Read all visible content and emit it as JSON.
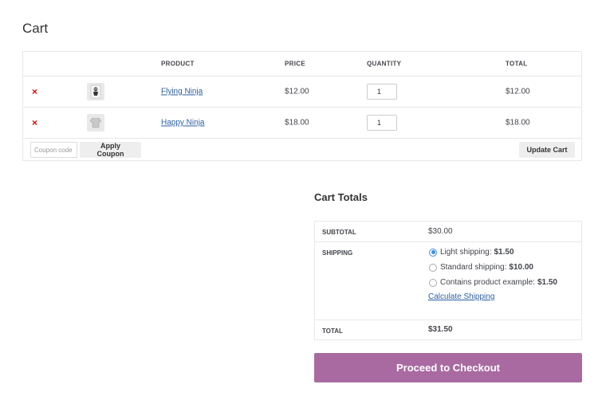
{
  "page": {
    "title": "Cart"
  },
  "cart": {
    "headers": {
      "product": "PRODUCT",
      "price": "PRICE",
      "quantity": "QUANTITY",
      "total": "TOTAL"
    },
    "items": [
      {
        "remove_icon": "×",
        "name": "Flying Ninja",
        "price": "$12.00",
        "quantity": "1",
        "total": "$12.00",
        "thumb_icon": "ninja-poster-icon"
      },
      {
        "remove_icon": "×",
        "name": "Happy Ninja",
        "price": "$18.00",
        "quantity": "1",
        "total": "$18.00",
        "thumb_icon": "tshirt-icon"
      }
    ],
    "coupon_placeholder": "Coupon code",
    "apply_label": "Apply Coupon",
    "update_label": "Update Cart"
  },
  "totals": {
    "title": "Cart Totals",
    "subtotal_label": "SUBTOTAL",
    "subtotal_value": "$30.00",
    "shipping_label": "SHIPPING",
    "shipping_options": [
      {
        "label": "Light shipping:",
        "price": "$1.50",
        "selected": true
      },
      {
        "label": "Standard shipping:",
        "price": "$10.00",
        "selected": false
      },
      {
        "label": "Contains product example:",
        "price": "$1.50",
        "selected": false
      }
    ],
    "calculate_label": "Calculate Shipping",
    "total_label": "TOTAL",
    "total_value": "$31.50"
  },
  "checkout": {
    "label": "Proceed to Checkout"
  },
  "colors": {
    "accent": "#a96aa1",
    "link": "#2c5fa3",
    "remove": "#dd0000",
    "radio": "#3a8ee6"
  }
}
